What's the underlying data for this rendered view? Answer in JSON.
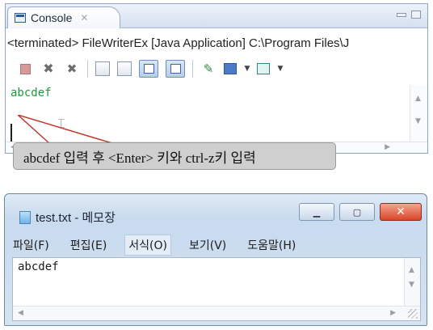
{
  "console": {
    "tab_label": "Console",
    "tab_close": "✕",
    "launch_info": "<terminated> FileWriterEx [Java Application] C:\\Program Files\\J",
    "output_text": "abcdef",
    "icons": [
      "terminate-icon",
      "remove-launch-icon",
      "remove-all-terminated-icon",
      "clear-console-icon",
      "scroll-lock-icon",
      "show-on-stdout-icon",
      "show-on-stderr-icon",
      "pin-console-icon",
      "display-selected-console-icon",
      "open-console-icon"
    ]
  },
  "callout": {
    "text": "abcdef 입력 후 <Enter> 키와 ctrl-z키 입력"
  },
  "notepad": {
    "title": "test.txt - 메모장",
    "menu": [
      "파일(F)",
      "편집(E)",
      "서식(O)",
      "보기(V)",
      "도움말(H)"
    ],
    "content": "abcdef",
    "close_glyph": "✕"
  }
}
